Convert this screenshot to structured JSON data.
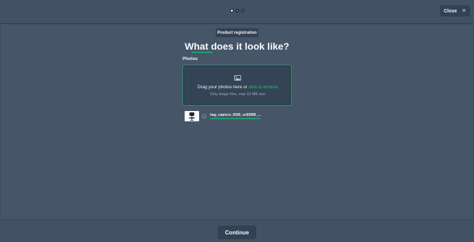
{
  "header": {
    "steps": [
      {
        "active": true
      },
      {
        "active": false
      },
      {
        "active": false
      }
    ],
    "close_label": "Close",
    "close_icon": "close-icon"
  },
  "main": {
    "badge": "Product registration",
    "title": "What does it look like?",
    "photos_label": "Photos",
    "dropzone": {
      "icon": "image-icon",
      "text": "Drag your photos here or",
      "link": "click to browse",
      "hint": "Only image files, max 10 MB size"
    },
    "file": {
      "name": "hag_capisco_8106_sc60999_...",
      "status_icon": "check-circle-icon",
      "progress": 1.0
    }
  },
  "footer": {
    "continue_label": "Continue"
  },
  "colors": {
    "background": "#475569",
    "surface": "#334155",
    "accent": "#22a06b",
    "link": "#22c55e"
  }
}
